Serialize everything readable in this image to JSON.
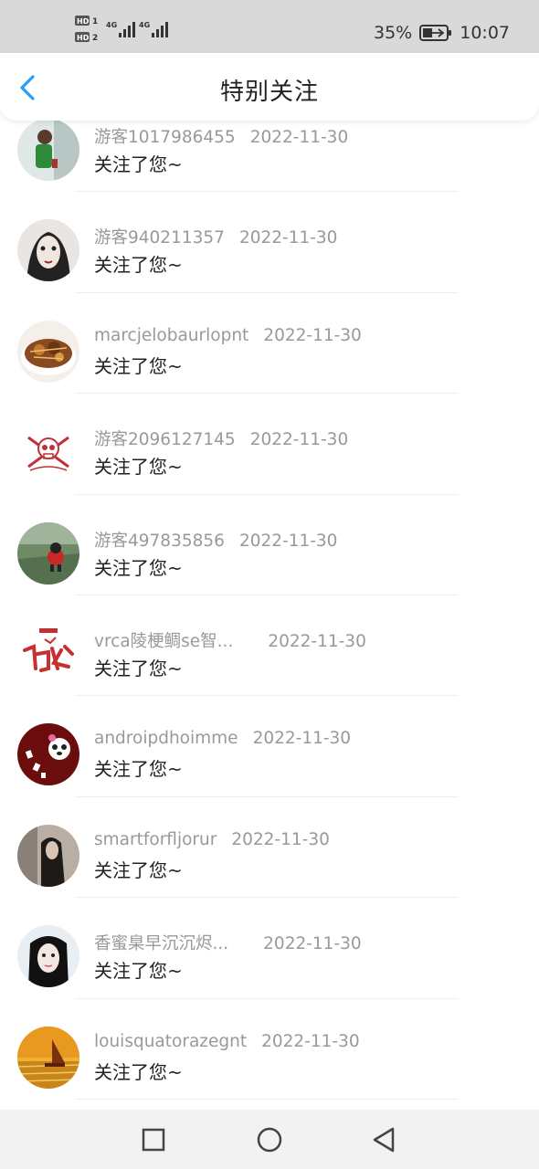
{
  "status_bar": {
    "sim1_label": "HD 1",
    "sim2_label": "HD 2",
    "network1": "4G",
    "network2": "4G",
    "battery": "35%",
    "time": "10:07"
  },
  "header": {
    "title": "特别关注",
    "back_icon": "chevron-left-icon",
    "accent_color": "#2a9df4"
  },
  "list": {
    "items": [
      {
        "username": "游客1017986455",
        "date": "2022-11-30",
        "message": "关注了您~"
      },
      {
        "username": "游客940211357",
        "date": "2022-11-30",
        "message": "关注了您~"
      },
      {
        "username": "marcjelobaurlopnt",
        "date": "2022-11-30",
        "message": "关注了您~"
      },
      {
        "username": "游客2096127145",
        "date": "2022-11-30",
        "message": "关注了您~"
      },
      {
        "username": "游客497835856",
        "date": "2022-11-30",
        "message": "关注了您~"
      },
      {
        "username": "vrca陵梗鲷se智...",
        "date": "2022-11-30",
        "message": "关注了您~"
      },
      {
        "username": "androipdhoimme",
        "date": "2022-11-30",
        "message": "关注了您~"
      },
      {
        "username": "smartforfljorur",
        "date": "2022-11-30",
        "message": "关注了您~"
      },
      {
        "username": "香蜜臬早沉沉烬...",
        "date": "2022-11-30",
        "message": "关注了您~"
      },
      {
        "username": "louisquatorazegnt",
        "date": "2022-11-30",
        "message": "关注了您~"
      }
    ]
  },
  "nav_bar": {
    "recent_icon": "square-icon",
    "home_icon": "circle-icon",
    "back_icon": "triangle-back-icon"
  }
}
